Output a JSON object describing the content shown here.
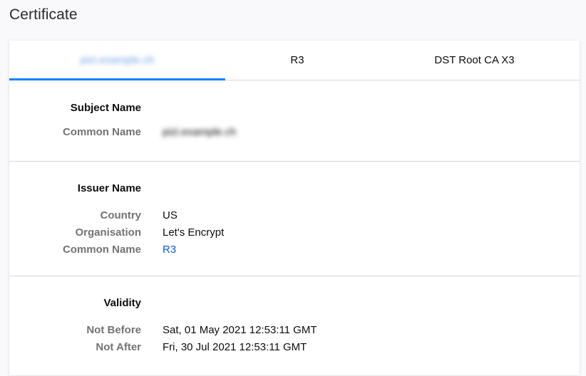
{
  "page": {
    "title": "Certificate"
  },
  "tabs": [
    {
      "label": "pizi.example.ch",
      "blurred": true,
      "active": true
    },
    {
      "label": "R3",
      "blurred": false,
      "active": false
    },
    {
      "label": "DST Root CA X3",
      "blurred": false,
      "active": false
    }
  ],
  "subject": {
    "heading": "Subject Name",
    "common_name_label": "Common Name",
    "common_name_value": "pizi.example.ch"
  },
  "issuer": {
    "heading": "Issuer Name",
    "country_label": "Country",
    "country_value": "US",
    "organisation_label": "Organisation",
    "organisation_value": "Let's Encrypt",
    "common_name_label": "Common Name",
    "common_name_value": "R3"
  },
  "validity": {
    "heading": "Validity",
    "not_before_label": "Not Before",
    "not_before_value": "Sat, 01 May 2021 12:53:11 GMT",
    "not_after_label": "Not After",
    "not_after_value": "Fri, 30 Jul 2021 12:53:11 GMT"
  },
  "colors": {
    "accent": "#0a84ff",
    "link": "#0060df",
    "label": "#737373"
  }
}
